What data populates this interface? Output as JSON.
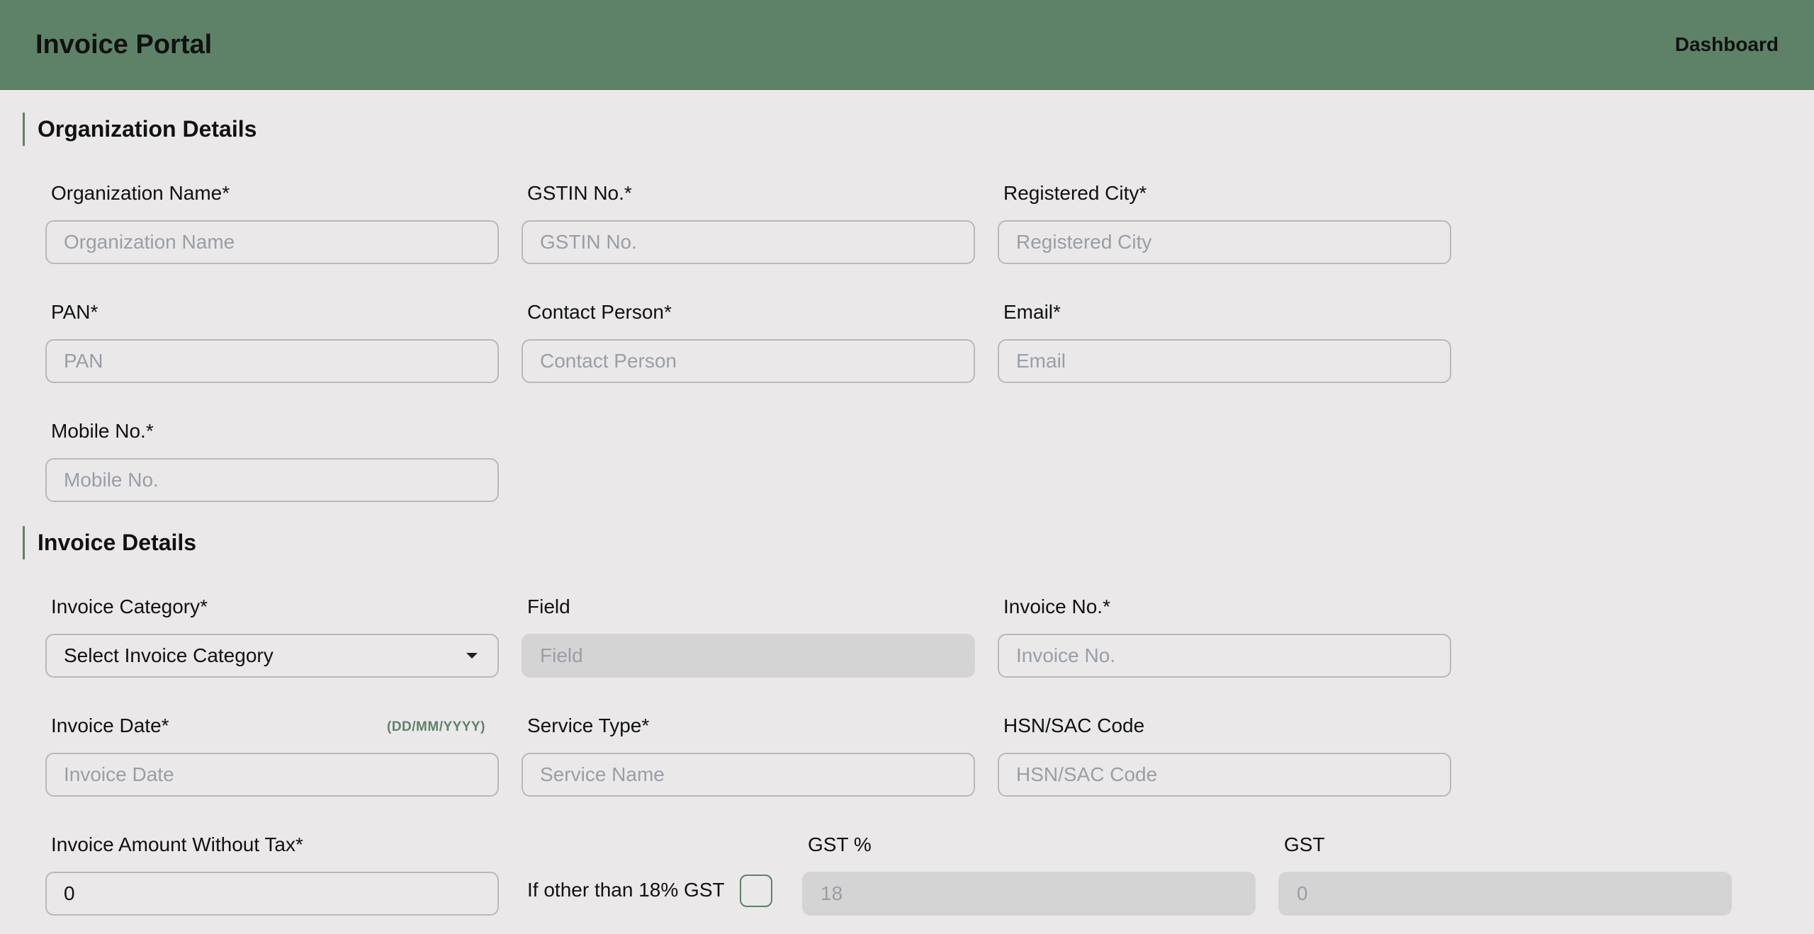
{
  "header": {
    "title": "Invoice Portal",
    "nav_dashboard": "Dashboard"
  },
  "org": {
    "section_title": "Organization Details",
    "org_name": {
      "label": "Organization Name*",
      "placeholder": "Organization Name"
    },
    "gstin": {
      "label": "GSTIN No.*",
      "placeholder": "GSTIN No."
    },
    "city": {
      "label": "Registered City*",
      "placeholder": "Registered City"
    },
    "pan": {
      "label": "PAN*",
      "placeholder": "PAN"
    },
    "contact": {
      "label": "Contact Person*",
      "placeholder": "Contact Person"
    },
    "email": {
      "label": "Email*",
      "placeholder": "Email"
    },
    "mobile": {
      "label": "Mobile No.*",
      "placeholder": "Mobile No."
    }
  },
  "invoice": {
    "section_title": "Invoice Details",
    "category": {
      "label": "Invoice Category*",
      "selected": "Select Invoice Category"
    },
    "field": {
      "label": "Field",
      "placeholder": "Field"
    },
    "invoice_no": {
      "label": "Invoice No.*",
      "placeholder": "Invoice No."
    },
    "date": {
      "label": "Invoice Date*",
      "hint": "(DD/MM/YYYY)",
      "placeholder": "Invoice Date"
    },
    "service": {
      "label": "Service Type*",
      "placeholder": "Service Name"
    },
    "hsn": {
      "label": "HSN/SAC Code",
      "placeholder": "HSN/SAC Code"
    },
    "amount": {
      "label": "Invoice Amount Without Tax*",
      "value": "0"
    },
    "other_gst": {
      "label": "If other than 18% GST"
    },
    "gst_pct": {
      "label": "GST %",
      "placeholder": "18"
    },
    "gst": {
      "label": "GST",
      "placeholder": "0"
    }
  },
  "colors": {
    "accent": "#5e8268",
    "background": "#eae8e9",
    "disabled": "#d5d4d5"
  }
}
